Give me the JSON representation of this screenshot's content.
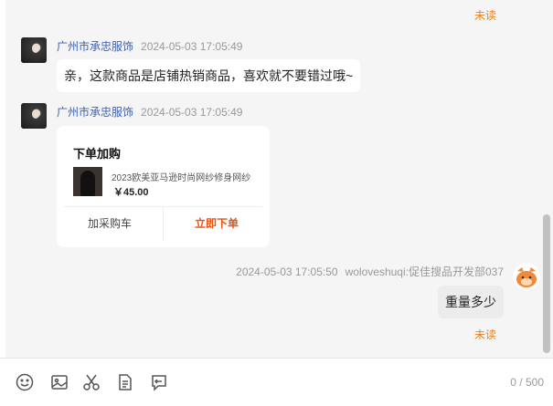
{
  "messages": {
    "unread_top": "未读",
    "msg1": {
      "shop": "广州市承忠服饰",
      "time": "2024-05-03 17:05:49",
      "text": "亲，这款商品是店铺热销商品，喜欢就不要错过哦~"
    },
    "msg2": {
      "shop": "广州市承忠服饰",
      "time": "2024-05-03 17:05:49",
      "card": {
        "title": "下单加购",
        "product_name": "2023欧美亚马逊时尚网纱修身网纱",
        "price": "￥45.00",
        "add_cart_label": "加采购车",
        "order_now_label": "立即下单"
      }
    },
    "msg3": {
      "time": "2024-05-03 17:05:50",
      "sender": "woloveshuqi:促佳搜品开发部037",
      "text": "重量多少",
      "status": "未读"
    }
  },
  "toolbar": {
    "icons": [
      "emoji-icon",
      "image-icon",
      "scissors-icon",
      "file-icon",
      "quote-icon"
    ],
    "counter": "0 / 500"
  },
  "colors": {
    "accent_orange": "#e8530f",
    "unread_orange": "#e8821a",
    "shop_blue": "#3b5fb0",
    "chat_bg": "#f5f5f5"
  }
}
